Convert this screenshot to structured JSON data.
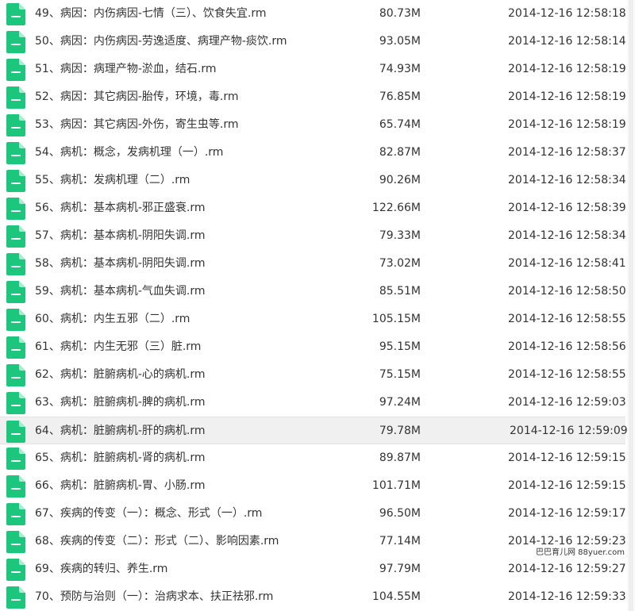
{
  "colors": {
    "icon_green": "#1cc67c",
    "text": "#333333",
    "highlight_row_bg": "#f0f0f0"
  },
  "files": [
    {
      "name": "49、病因：内伤病因-七情（三）、饮食失宜.rm",
      "size": "80.73M",
      "date": "2014-12-16 12:58:18"
    },
    {
      "name": "50、病因：内伤病因-劳逸适度、病理产物-痰饮.rm",
      "size": "93.05M",
      "date": "2014-12-16 12:58:14"
    },
    {
      "name": "51、病因：病理产物-淤血，结石.rm",
      "size": "74.93M",
      "date": "2014-12-16 12:58:19"
    },
    {
      "name": "52、病因：其它病因-胎传，环境，毒.rm",
      "size": "76.85M",
      "date": "2014-12-16 12:58:19"
    },
    {
      "name": "53、病因：其它病因-外伤，寄生虫等.rm",
      "size": "65.74M",
      "date": "2014-12-16 12:58:19"
    },
    {
      "name": "54、病机：概念，发病机理（一）.rm",
      "size": "82.87M",
      "date": "2014-12-16 12:58:37"
    },
    {
      "name": "55、病机：发病机理（二）.rm",
      "size": "90.26M",
      "date": "2014-12-16 12:58:34"
    },
    {
      "name": "56、病机：基本病机-邪正盛衰.rm",
      "size": "122.66M",
      "date": "2014-12-16 12:58:39"
    },
    {
      "name": "57、病机：基本病机-阴阳失调.rm",
      "size": "79.33M",
      "date": "2014-12-16 12:58:34"
    },
    {
      "name": "58、病机：基本病机-阴阳失调.rm",
      "size": "73.02M",
      "date": "2014-12-16 12:58:41"
    },
    {
      "name": "59、病机：基本病机-气血失调.rm",
      "size": "85.51M",
      "date": "2014-12-16 12:58:50"
    },
    {
      "name": "60、病机：内生五邪（二）.rm",
      "size": "105.15M",
      "date": "2014-12-16 12:58:55"
    },
    {
      "name": "61、病机：内生无邪（三）脏.rm",
      "size": "95.15M",
      "date": "2014-12-16 12:58:56"
    },
    {
      "name": "62、病机：脏腑病机-心的病机.rm",
      "size": "75.15M",
      "date": "2014-12-16 12:58:55"
    },
    {
      "name": "63、病机：脏腑病机-脾的病机.rm",
      "size": "97.24M",
      "date": "2014-12-16 12:59:03"
    },
    {
      "name": "64、病机：脏腑病机-肝的病机.rm",
      "size": "79.78M",
      "date": "2014-12-16 12:59:09",
      "highlighted": true
    },
    {
      "name": "65、病机：脏腑病机-肾的病机.rm",
      "size": "89.87M",
      "date": "2014-12-16 12:59:15"
    },
    {
      "name": "66、病机：脏腑病机-胃、小肠.rm",
      "size": "101.71M",
      "date": "2014-12-16 12:59:15"
    },
    {
      "name": "67、疾病的传变（一）：概念、形式（一）.rm",
      "size": "96.50M",
      "date": "2014-12-16 12:59:17"
    },
    {
      "name": "68、疾病的传变（二）：形式（二）、影响因素.rm",
      "size": "77.14M",
      "date": "2014-12-16 12:59:23"
    },
    {
      "name": "69、疾病的转归、养生.rm",
      "size": "97.79M",
      "date": "2014-12-16 12:59:27"
    },
    {
      "name": "70、预防与治则（一）：治病求本、扶正祛邪.rm",
      "size": "104.55M",
      "date": "2014-12-16 12:59:33"
    }
  ],
  "watermark": {
    "text": "巴巴育儿网 88yuer.com"
  }
}
